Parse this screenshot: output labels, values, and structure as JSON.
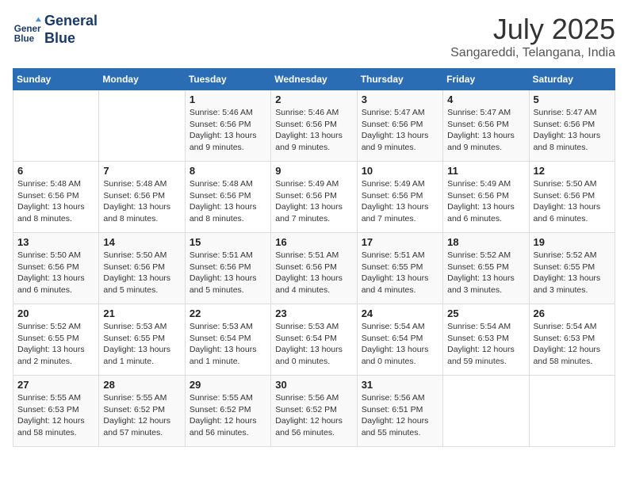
{
  "header": {
    "logo_line1": "General",
    "logo_line2": "Blue",
    "month_year": "July 2025",
    "location": "Sangareddi, Telangana, India"
  },
  "days_of_week": [
    "Sunday",
    "Monday",
    "Tuesday",
    "Wednesday",
    "Thursday",
    "Friday",
    "Saturday"
  ],
  "weeks": [
    [
      {
        "day": "",
        "info": ""
      },
      {
        "day": "",
        "info": ""
      },
      {
        "day": "1",
        "info": "Sunrise: 5:46 AM\nSunset: 6:56 PM\nDaylight: 13 hours\nand 9 minutes."
      },
      {
        "day": "2",
        "info": "Sunrise: 5:46 AM\nSunset: 6:56 PM\nDaylight: 13 hours\nand 9 minutes."
      },
      {
        "day": "3",
        "info": "Sunrise: 5:47 AM\nSunset: 6:56 PM\nDaylight: 13 hours\nand 9 minutes."
      },
      {
        "day": "4",
        "info": "Sunrise: 5:47 AM\nSunset: 6:56 PM\nDaylight: 13 hours\nand 9 minutes."
      },
      {
        "day": "5",
        "info": "Sunrise: 5:47 AM\nSunset: 6:56 PM\nDaylight: 13 hours\nand 8 minutes."
      }
    ],
    [
      {
        "day": "6",
        "info": "Sunrise: 5:48 AM\nSunset: 6:56 PM\nDaylight: 13 hours\nand 8 minutes."
      },
      {
        "day": "7",
        "info": "Sunrise: 5:48 AM\nSunset: 6:56 PM\nDaylight: 13 hours\nand 8 minutes."
      },
      {
        "day": "8",
        "info": "Sunrise: 5:48 AM\nSunset: 6:56 PM\nDaylight: 13 hours\nand 8 minutes."
      },
      {
        "day": "9",
        "info": "Sunrise: 5:49 AM\nSunset: 6:56 PM\nDaylight: 13 hours\nand 7 minutes."
      },
      {
        "day": "10",
        "info": "Sunrise: 5:49 AM\nSunset: 6:56 PM\nDaylight: 13 hours\nand 7 minutes."
      },
      {
        "day": "11",
        "info": "Sunrise: 5:49 AM\nSunset: 6:56 PM\nDaylight: 13 hours\nand 6 minutes."
      },
      {
        "day": "12",
        "info": "Sunrise: 5:50 AM\nSunset: 6:56 PM\nDaylight: 13 hours\nand 6 minutes."
      }
    ],
    [
      {
        "day": "13",
        "info": "Sunrise: 5:50 AM\nSunset: 6:56 PM\nDaylight: 13 hours\nand 6 minutes."
      },
      {
        "day": "14",
        "info": "Sunrise: 5:50 AM\nSunset: 6:56 PM\nDaylight: 13 hours\nand 5 minutes."
      },
      {
        "day": "15",
        "info": "Sunrise: 5:51 AM\nSunset: 6:56 PM\nDaylight: 13 hours\nand 5 minutes."
      },
      {
        "day": "16",
        "info": "Sunrise: 5:51 AM\nSunset: 6:56 PM\nDaylight: 13 hours\nand 4 minutes."
      },
      {
        "day": "17",
        "info": "Sunrise: 5:51 AM\nSunset: 6:55 PM\nDaylight: 13 hours\nand 4 minutes."
      },
      {
        "day": "18",
        "info": "Sunrise: 5:52 AM\nSunset: 6:55 PM\nDaylight: 13 hours\nand 3 minutes."
      },
      {
        "day": "19",
        "info": "Sunrise: 5:52 AM\nSunset: 6:55 PM\nDaylight: 13 hours\nand 3 minutes."
      }
    ],
    [
      {
        "day": "20",
        "info": "Sunrise: 5:52 AM\nSunset: 6:55 PM\nDaylight: 13 hours\nand 2 minutes."
      },
      {
        "day": "21",
        "info": "Sunrise: 5:53 AM\nSunset: 6:55 PM\nDaylight: 13 hours\nand 1 minute."
      },
      {
        "day": "22",
        "info": "Sunrise: 5:53 AM\nSunset: 6:54 PM\nDaylight: 13 hours\nand 1 minute."
      },
      {
        "day": "23",
        "info": "Sunrise: 5:53 AM\nSunset: 6:54 PM\nDaylight: 13 hours\nand 0 minutes."
      },
      {
        "day": "24",
        "info": "Sunrise: 5:54 AM\nSunset: 6:54 PM\nDaylight: 13 hours\nand 0 minutes."
      },
      {
        "day": "25",
        "info": "Sunrise: 5:54 AM\nSunset: 6:53 PM\nDaylight: 12 hours\nand 59 minutes."
      },
      {
        "day": "26",
        "info": "Sunrise: 5:54 AM\nSunset: 6:53 PM\nDaylight: 12 hours\nand 58 minutes."
      }
    ],
    [
      {
        "day": "27",
        "info": "Sunrise: 5:55 AM\nSunset: 6:53 PM\nDaylight: 12 hours\nand 58 minutes."
      },
      {
        "day": "28",
        "info": "Sunrise: 5:55 AM\nSunset: 6:52 PM\nDaylight: 12 hours\nand 57 minutes."
      },
      {
        "day": "29",
        "info": "Sunrise: 5:55 AM\nSunset: 6:52 PM\nDaylight: 12 hours\nand 56 minutes."
      },
      {
        "day": "30",
        "info": "Sunrise: 5:56 AM\nSunset: 6:52 PM\nDaylight: 12 hours\nand 56 minutes."
      },
      {
        "day": "31",
        "info": "Sunrise: 5:56 AM\nSunset: 6:51 PM\nDaylight: 12 hours\nand 55 minutes."
      },
      {
        "day": "",
        "info": ""
      },
      {
        "day": "",
        "info": ""
      }
    ]
  ]
}
